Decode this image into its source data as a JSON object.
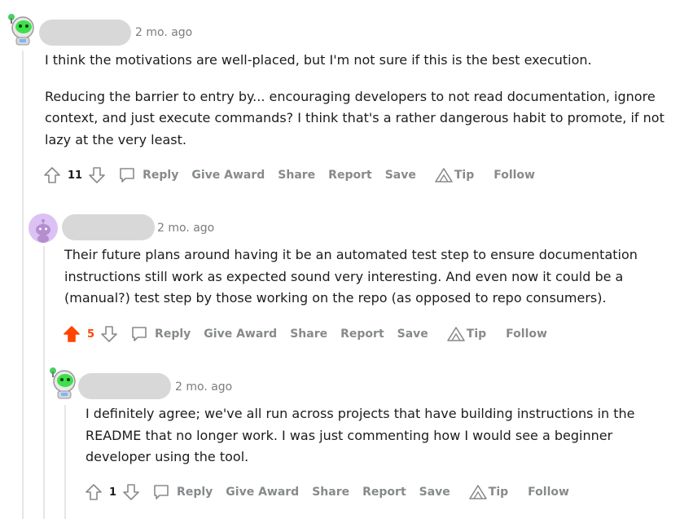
{
  "comments": [
    {
      "time": "2 mo. ago",
      "paragraphs": [
        "I think the motivations are well-placed, but I'm not sure if this is the best execution.",
        "Reducing the barrier to entry by... encouraging developers to not read documentation, ignore context, and just execute commands? I think that's a rather dangerous habit to promote, if not lazy at the very least."
      ],
      "score": "11",
      "upvoted": false,
      "avatar_icon": "robot-avatar-icon"
    },
    {
      "time": "2 mo. ago",
      "paragraphs": [
        "Their future plans around having it be an automated test step to ensure documentation instructions still work as expected sound very interesting. And even now it could be a (manual?) test step by those working on the repo (as opposed to repo consumers)."
      ],
      "score": "5",
      "upvoted": true,
      "avatar_icon": "snoo-avatar-icon"
    },
    {
      "time": "2 mo. ago",
      "paragraphs": [
        "I definitely agree; we've all run across projects that have building instructions in the README that no longer work. I was just commenting how I would see a beginner developer using the tool."
      ],
      "score": "1",
      "upvoted": false,
      "avatar_icon": "robot-avatar-icon"
    }
  ],
  "actions": {
    "reply": "Reply",
    "give_award": "Give Award",
    "share": "Share",
    "report": "Report",
    "save": "Save",
    "tip": "Tip",
    "follow": "Follow"
  },
  "colors": {
    "upvote_active": "#ff4500",
    "action_text": "#878a8c",
    "thread_line": "#e6e6e6",
    "name_pill": "#d8d8d8"
  }
}
